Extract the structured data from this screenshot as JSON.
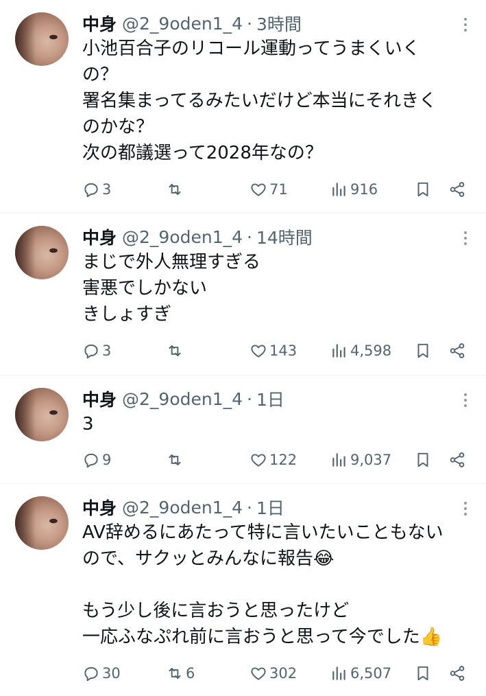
{
  "tweets": [
    {
      "name": "中身",
      "handle": "@2_9oden1_4",
      "time": "3時間",
      "text": "小池百合子のリコール運動ってうまくいく\nの？\n署名集まってるみたいだけど本当にそれきく\nのかな？\n次の都議選って2028年なの？",
      "replies": "3",
      "retweets": "",
      "likes": "71",
      "views": "916"
    },
    {
      "name": "中身",
      "handle": "@2_9oden1_4",
      "time": "14時間",
      "text": "まじで外人無理すぎる\n害悪でしかない\nきしょすぎ",
      "replies": "3",
      "retweets": "",
      "likes": "143",
      "views": "4,598"
    },
    {
      "name": "中身",
      "handle": "@2_9oden1_4",
      "time": "1日",
      "text": "3",
      "replies": "9",
      "retweets": "",
      "likes": "122",
      "views": "9,037"
    },
    {
      "name": "中身",
      "handle": "@2_9oden1_4",
      "time": "1日",
      "text": "AV辞めるにあたって特に言いたいこともない\nので、サクッとみんなに報告😂\n\nもう少し後に言おうと思ったけど\n一応ふなぷれ前に言おうと思って今でした👍",
      "replies": "30",
      "retweets": "6",
      "likes": "302",
      "views": "6,507"
    }
  ],
  "separator": "·",
  "icons": {
    "reply": "reply-icon",
    "retweet": "retweet-icon",
    "like": "heart-icon",
    "views": "views-icon",
    "bookmark": "bookmark-icon",
    "share": "share-icon",
    "more": "more-dots-icon"
  },
  "colors": {
    "text": "#0f1419",
    "secondary": "#536471",
    "divider": "#eff3f4"
  }
}
